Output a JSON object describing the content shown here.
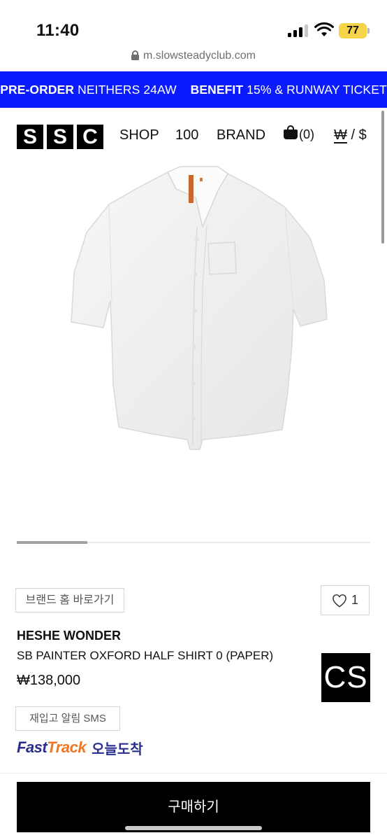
{
  "status_bar": {
    "time": "11:40",
    "battery": "77"
  },
  "browser": {
    "url": "m.slowsteadyclub.com"
  },
  "promo": {
    "part1_bold": "PRE-ORDER",
    "part1_text": " NEITHERS 24AW",
    "part2_bold": "BENEFIT",
    "part2_text": " 15% & RUNWAY TICKET"
  },
  "header": {
    "logo_letters": [
      "S",
      "S",
      "C"
    ],
    "nav": [
      "SHOP",
      "100",
      "BRAND"
    ],
    "cart_count": "(0)",
    "currency_won": "₩",
    "currency_sep": " / ",
    "currency_usd": "$"
  },
  "gallery": {
    "position": 0.2
  },
  "product": {
    "brand_home_label": "브랜드 홈 바로가기",
    "like_count": "1",
    "brand": "HESHE WONDER",
    "name": "SB PAINTER OXFORD HALF SHIRT 0 (PAPER)",
    "price": "₩138,000",
    "cs_badge": "CS",
    "restock_label": "재입고 알림 SMS",
    "fasttrack_fast": "Fast",
    "fasttrack_track": "Track",
    "fasttrack_today": "오늘도착"
  },
  "actions": {
    "buy_label": "구매하기"
  },
  "colors": {
    "promo_bg": "#0a1cff",
    "fasttrack_blue": "#2a2f8f",
    "fasttrack_orange": "#f07824",
    "battery": "#f5d34a"
  }
}
